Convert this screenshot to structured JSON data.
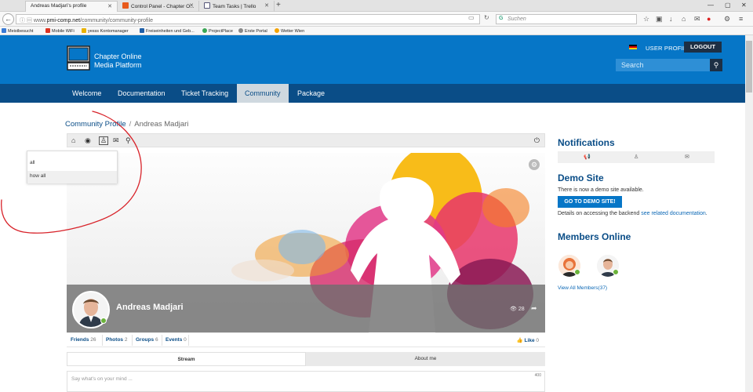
{
  "browser": {
    "tabs": [
      {
        "title": "Andreas Madjari's profile"
      },
      {
        "title": "Control Panel - Chapter O..."
      },
      {
        "title": "Team Tasks | Trello"
      }
    ],
    "url_prefix": "www.",
    "url_domain": "pmi-comp.net",
    "url_path": "/community/community-profile",
    "search_placeholder": "Suchen",
    "bookmarks": [
      "Meistbesucht",
      "Mobile WiFi",
      "yesss Kontomanager",
      "Freiseinheiten und Geb...",
      "ProjectPlace",
      "Erste Portal",
      "Wetter Wien"
    ]
  },
  "header": {
    "logo_line1": "Chapter Online",
    "logo_line2": "Media Platform",
    "user_profile": "USER PROFILE",
    "logout": "LOGOUT",
    "search_placeholder": "Search"
  },
  "nav": {
    "items": [
      "Welcome",
      "Documentation",
      "Ticket Tracking",
      "Community",
      "Package"
    ],
    "active": "Community"
  },
  "breadcrumb": {
    "parent": "Community Profile",
    "current": "Andreas Madjari"
  },
  "dropdown": {
    "items": [
      "all",
      "how all"
    ]
  },
  "profile": {
    "name": "Andreas Madjari",
    "views": "28",
    "stats": [
      {
        "label": "Friends",
        "count": "26"
      },
      {
        "label": "Photos",
        "count": "2"
      },
      {
        "label": "Groups",
        "count": "6"
      },
      {
        "label": "Events",
        "count": "0"
      }
    ],
    "like_label": "Like",
    "like_count": "0",
    "tabs": [
      "Stream",
      "About me"
    ],
    "post_placeholder": "Say what's on your mind ...",
    "post_counter": "400"
  },
  "sidebar": {
    "notifications_title": "Notifications",
    "demo_title": "Demo Site",
    "demo_text": "There is now a demo site available.",
    "demo_button": "GO TO DEMO SITE!",
    "demo_details_prefix": "Details on accessing the backend",
    "demo_details_link": "see related documentation",
    "demo_details_suffix": ".",
    "members_title": "Members Online",
    "view_all": "View All Members(37)"
  },
  "colors": {
    "brand_blue": "#0676c7",
    "nav_dark": "#0a4d87",
    "logout_bg": "#1d2f44",
    "online_green": "#6bb33a",
    "annotation_red": "#d8232a"
  }
}
